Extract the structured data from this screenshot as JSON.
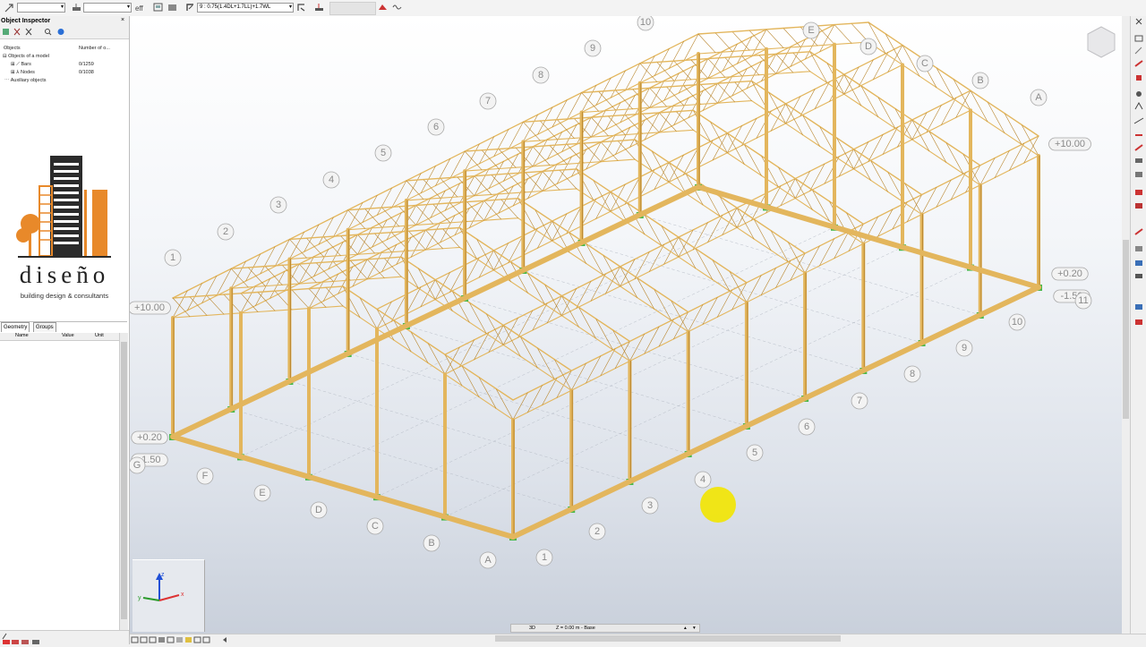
{
  "toolbar": {
    "combo1": "",
    "combo2": "",
    "load_case": "9 : 0.75(1.4DL+1.7LL)+1.7WL"
  },
  "object_inspector": {
    "title": "Object Inspector",
    "col_objects": "Objects",
    "col_number": "Number of o...",
    "tree": [
      {
        "label": "Objects of a model",
        "count": ""
      },
      {
        "label": "Bars",
        "count": "0/1259"
      },
      {
        "label": "Nodes",
        "count": "0/1038"
      },
      {
        "label": "Auxiliary objects",
        "count": ""
      }
    ]
  },
  "logo": {
    "name": "diseño",
    "tagline": "building design & consultants"
  },
  "tabs": [
    {
      "label": "Geometry"
    },
    {
      "label": "Groups"
    }
  ],
  "props_columns": [
    "Name",
    "Value",
    "Unit"
  ],
  "viewport": {
    "levels": {
      "top_right": "+10.00",
      "top_left": "+10.00",
      "base_right": "+0.20",
      "base_right_low": "-1.50",
      "base_left": "+0.20",
      "base_left_low": "-1.50",
      "right_num": "11",
      "left_letter": "G"
    },
    "grid_numbers_top": [
      "1",
      "2",
      "3",
      "4",
      "5",
      "6",
      "7",
      "8",
      "9",
      "10"
    ],
    "grid_letters_right": [
      "A",
      "B",
      "C",
      "D",
      "E"
    ],
    "grid_numbers_bottom": [
      "1",
      "2",
      "3",
      "4",
      "5",
      "6",
      "7",
      "8",
      "9",
      "10"
    ],
    "grid_letters_bottom": [
      "A",
      "B",
      "C",
      "D",
      "E",
      "F"
    ],
    "axes": {
      "x": "x",
      "y": "y",
      "z": "z"
    }
  },
  "view_info": {
    "mode": "3D",
    "plane": "Z = 0.00 m - Base"
  },
  "colors": {
    "steel": "#e3b65d",
    "steel_dark": "#b9862e",
    "support": "#49b84a",
    "cursor": "#f2e600"
  }
}
